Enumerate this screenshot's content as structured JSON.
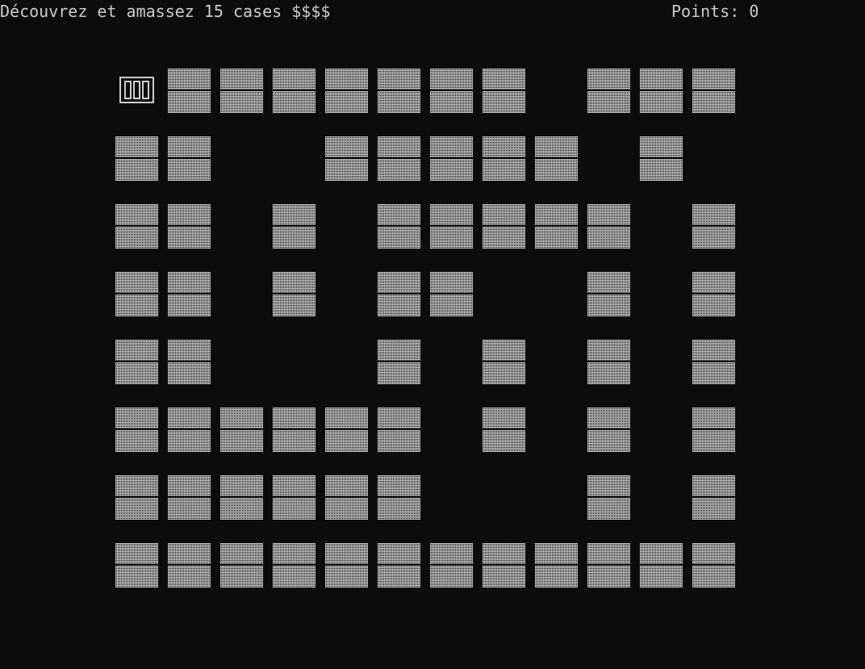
{
  "status": {
    "instruction": "Découvrez et amassez 15 cases $$$$",
    "score": "Points: 0"
  },
  "colors": {
    "background": "#0c0c0c",
    "foreground": "#cccccc"
  },
  "icons": {
    "player_cursor": "player-cursor-icon",
    "hidden_tile": "hidden-tile-block-icon"
  },
  "board": {
    "rows": 8,
    "cols": 12,
    "legend": {
      "#": "hidden-tile",
      ".": "empty-cell",
      "P": "player-cursor"
    },
    "grid": [
      "P#######.###",
      "##..#####.#.",
      "##.#.#####.#",
      "##.#.##..#.#",
      "##..#.#.#.#",
      "######.#.#.#",
      "######...#.#",
      "############"
    ]
  }
}
